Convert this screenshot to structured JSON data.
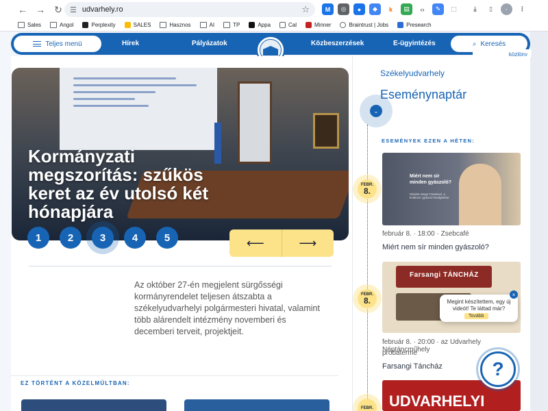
{
  "browser": {
    "url": "udvarhely.ro",
    "bookmarks": [
      "Sales",
      "Angol",
      "Perplexity",
      "SALES",
      "Hasznos",
      "AI",
      "TP",
      "Appa",
      "Cal",
      "Minner",
      "Braintrust | Jobs",
      "Presearch"
    ]
  },
  "nav": {
    "menu_label": "Teljes menü",
    "links": [
      "Hírek",
      "Pályázatok",
      "Közbeszerzések",
      "E-ügyintézés"
    ],
    "search_label": "Keresés",
    "kozlony_label": "közlöny"
  },
  "hero": {
    "title": "Kormányzati megszorítás: szűkös keret az év utolsó két hónapjára",
    "pages": [
      "1",
      "2",
      "3",
      "4",
      "5"
    ],
    "active_page": 3,
    "prev_arrow": "⟵",
    "next_arrow": "⟶"
  },
  "lead": "Az október 27-én megjelent sürgősségi kormányrendelet teljesen átszabta a székelyudvarhelyi polgármesteri hivatal, valamint több alárendelt intézmény novemberi és decemberi terveit, projektjeit.",
  "recent_label": "EZ TÖRTÉNT A KÖZELMÚLTBAN:",
  "events": {
    "city": "Székelyudvarhely",
    "heading": "Eseménynaptár",
    "week_label": "ESEMÉNYEK EZEN A HÉTEN:",
    "items": [
      {
        "month": "FEBR.",
        "day": "8.",
        "image_text": "Miért nem sír minden gyászoló?",
        "image_sub": "Dávida-Varga Tündevel, a koldezer gyászol lesülgetése",
        "meta": "február 8. · 18:00 · Zsebcafé",
        "title": "Miért nem sír minden gyászoló?"
      },
      {
        "month": "FEBR.",
        "day": "8.",
        "image_text": "Farsangi TÁNCHÁZ",
        "meta": "február 8. · 20:00 · az Udvarhely Néptáncműhely",
        "meta2": "próbaterme",
        "title": "Farsangi Táncház"
      },
      {
        "month": "FEBR.",
        "day": "",
        "image_text": "UDVARHELYI"
      }
    ]
  },
  "popup": {
    "message": "Megint készítettem, egy új videót! Te láttad már?",
    "button": "Tovább",
    "close": "×"
  },
  "help_label": "?"
}
